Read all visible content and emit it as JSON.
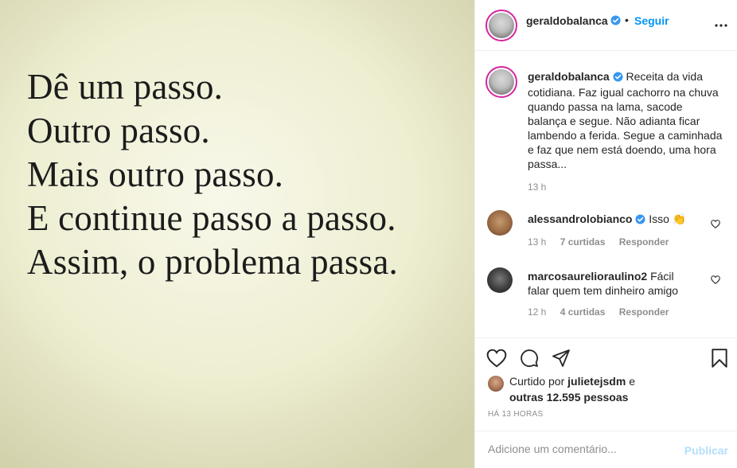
{
  "post_image": {
    "lines": [
      "Dê um passo.",
      "Outro passo.",
      "Mais outro passo.",
      "E continue passo a passo.",
      "Assim, o problema passa."
    ]
  },
  "header": {
    "username": "geraldobalanca",
    "separator": "•",
    "follow_label": "Seguir",
    "more_icon": "more-horizontal-icon"
  },
  "caption": {
    "username": "geraldobalanca",
    "text": "Receita da vida cotidiana. Faz igual cachorro na chuva quando passa na lama, sacode balança e segue. Não adianta ficar lambendo a ferida. Segue a caminhada e faz que nem está doendo, uma hora passa...",
    "time": "13 h"
  },
  "comments": [
    {
      "username": "alessandrolobianco",
      "text": "Isso 👏",
      "time": "13 h",
      "likes": "7 curtidas",
      "reply_label": "Responder"
    },
    {
      "username": "marcosaurelioraulino2",
      "text": "Fácil falar quem tem dinheiro amigo",
      "time": "12 h",
      "likes": "4 curtidas",
      "reply_label": "Responder"
    }
  ],
  "likes": {
    "prefix": "Curtido por",
    "liker": "julietejsdm",
    "conj": "e",
    "others": "outras 12.595 pessoas"
  },
  "timestamp": "HÁ 13 HORAS",
  "comment_box": {
    "placeholder": "Adicione um comentário...",
    "publish_label": "Publicar"
  },
  "colors": {
    "accent": "#0095f6",
    "verified": "#3897f0",
    "muted": "#8e8e8e",
    "publish_disabled": "#b2dffc"
  }
}
